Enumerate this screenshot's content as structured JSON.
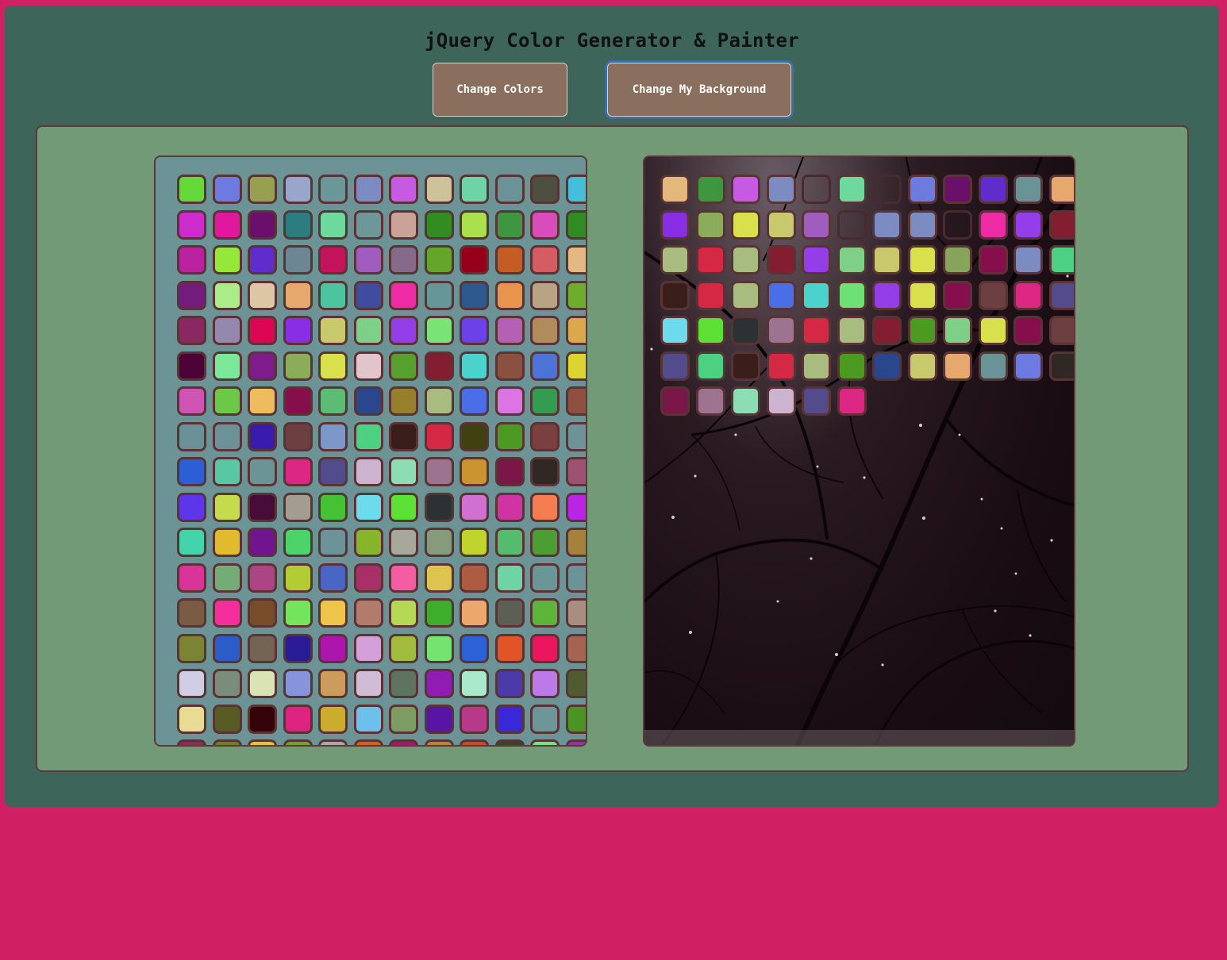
{
  "app": {
    "title": "jQuery Color Generator & Painter",
    "buttons": {
      "change_colors": "Change Colors",
      "change_background": "Change My Background"
    }
  },
  "theme": {
    "page_background": "#d01f63",
    "app_background": "#3d6559",
    "panel_background": "#739a76",
    "palette_background": "#6c9496",
    "button_background": "#8a6e5e",
    "swatch_border": "#5a3434"
  },
  "palette_colors": [
    "#66d93a",
    "#6d7ae0",
    "#96a04e",
    "#98a6cc",
    "#6a9898",
    "#7c8cc2",
    "#c75ae3",
    "#cdc29a",
    "#6cd4a6",
    "#6a9398",
    "#4d5040",
    "#43bfdc",
    "#cc2ccb",
    "#e018a0",
    "#6a0f6c",
    "#2c7c80",
    "#6dd99c",
    "#6e9898",
    "#c9a298",
    "#338c22",
    "#a9e04c",
    "#3f9640",
    "#d94cbc",
    "#2e8c22",
    "#bb22a0",
    "#95e83a",
    "#5e2dcc",
    "#6d8694",
    "#c4145c",
    "#a15cc0",
    "#866a8c",
    "#64a62a",
    "#960018",
    "#c45c24",
    "#d65c64",
    "#e4b882",
    "#731c7e",
    "#a9ec88",
    "#dcc6a4",
    "#e6a86c",
    "#4cc49e",
    "#3f4ca0",
    "#ee2aa4",
    "#679698",
    "#2d5a8e",
    "#e8944c",
    "#b8a484",
    "#6cae2c",
    "#8a2862",
    "#9488ae",
    "#dc0652",
    "#8a2ee6",
    "#c8c86c",
    "#7ed086",
    "#933ee8",
    "#78e476",
    "#6c42e8",
    "#b460b4",
    "#b08c5c",
    "#dca84c",
    "#4c0438",
    "#7ae898",
    "#7e1c8e",
    "#8cac5c",
    "#d8e04c",
    "#e4c4cc",
    "#58a02e",
    "#821e30",
    "#4cd2cc",
    "#8a5040",
    "#4c74d8",
    "#dcd430",
    "#d054b4",
    "#6cc948",
    "#eebc5c",
    "#860e4c",
    "#5cbc74",
    "#2a468c",
    "#96802c",
    "#a8bc80",
    "#4a6ee8",
    "#dc74e4",
    "#349c50",
    "#8e5040",
    "#6a9198",
    "#6c9298",
    "#3a1cac",
    "#6c4040",
    "#7c98c8",
    "#4cd081",
    "#3a1e1c",
    "#d42844",
    "#404010",
    "#4c9a22",
    "#7a4040",
    "#6c9398",
    "#2c5ed8",
    "#58c8a4",
    "#6a9496",
    "#dc2884",
    "#524c8c",
    "#ccb4d0",
    "#8cdcb4",
    "#9c7490",
    "#cc9430",
    "#7a1648",
    "#302824",
    "#9c5270",
    "#5c36e8",
    "#c4dc4c",
    "#480c38",
    "#a49c8e",
    "#44c234",
    "#6cdcec",
    "#5ce034",
    "#2c3234",
    "#d070d0",
    "#d034a4",
    "#f47c50",
    "#ba24e4",
    "#44d4ac",
    "#e2ba2e",
    "#701490",
    "#4cd46a",
    "#6c9498",
    "#86b42a",
    "#a6a89c",
    "#869a7c",
    "#c0d42e",
    "#54bc6c",
    "#4c9e34",
    "#a4823c",
    "#d8349a",
    "#74ac78",
    "#ac4486",
    "#b4cc34",
    "#4a66c4",
    "#a83068",
    "#f45ca4",
    "#dcc44e",
    "#ac5c40",
    "#6ed4a6",
    "#6a9698",
    "#6c9498",
    "#7a5c44",
    "#f42e9a",
    "#784c28",
    "#74e45c",
    "#eec44a",
    "#b27c6c",
    "#b4d854",
    "#3cae2c",
    "#eca86c",
    "#5c6054",
    "#5cb43a",
    "#a88e80",
    "#7a8434",
    "#2c5cc8",
    "#746454",
    "#2a1c94",
    "#ac16ac",
    "#d4a0dc",
    "#a0bc3c",
    "#74e470",
    "#2c62d8",
    "#e05428",
    "#ec1660",
    "#a46450",
    "#d0cee4",
    "#7c8c7c",
    "#d8e4b4",
    "#8694dc",
    "#cc9c5c",
    "#d0bcd4",
    "#5e7460",
    "#901cb4",
    "#aae8cc",
    "#4a3aaa",
    "#bc7ae8",
    "#4e5c30",
    "#e8dc94",
    "#565c24",
    "#340408",
    "#dc2480",
    "#ccac2c",
    "#6ec0ec",
    "#7c9c64",
    "#5814a4",
    "#b8388a",
    "#3828d8",
    "#6c9698",
    "#4a9424",
    "#8c2c5c",
    "#6e7e26",
    "#dcc82c",
    "#6ea42c",
    "#a8a8a8",
    "#d85c24",
    "#a81470",
    "#b8843c",
    "#c44c2c",
    "#2e4a24",
    "#74e482",
    "#8c34ac"
  ],
  "painted_colors": [
    "#e4b87c",
    "#3f9640",
    "#c75ae3",
    "#7c8cc2",
    "transparent",
    "#6dd99c",
    "transparent",
    "#6d7ae0",
    "#6a0f6c",
    "#5e2dcc",
    "#6a9398",
    "#e6a86c",
    "#8a2ee6",
    "#8cac5c",
    "#d8e04c",
    "#c8c86c",
    "#a15cc0",
    "transparent",
    "#7c8cc2",
    "#7c8cc2",
    "transparent",
    "#ee2aa4",
    "#933ee8",
    "#821e30",
    "#a8bc80",
    "#d42844",
    "#a8bc80",
    "#821e30",
    "#933ee8",
    "#7ed086",
    "#c8c86c",
    "#d8e04c",
    "#86a45c",
    "#860e4c",
    "#7c8cc2",
    "#4cd081",
    "#3a1e1c",
    "#d42844",
    "#a8bc80",
    "#4a6ee8",
    "#4cd2cc",
    "#6de076",
    "#933ee8",
    "#d8e04c",
    "#860e4c",
    "#6c4040",
    "#dc2884",
    "#524c8c",
    "#6cdcec",
    "#5ce034",
    "#2c3234",
    "#9c7490",
    "#d42844",
    "#a8bc80",
    "#821e30",
    "#4c9a22",
    "#7ed086",
    "#d8e04c",
    "#860e4c",
    "#6c4040",
    "#524c8c",
    "#4cd081",
    "#3a1e1c",
    "#d42844",
    "#a8bc80",
    "#4c9a22",
    "#2a468c",
    "#c8c86c",
    "#e6a86c",
    "#6a9398",
    "#6d7ae0",
    "#302824",
    "#7a1648",
    "#9c7490",
    "#8cdcb4",
    "#ccb4d0",
    "#524c8c",
    "#dc2884"
  ]
}
